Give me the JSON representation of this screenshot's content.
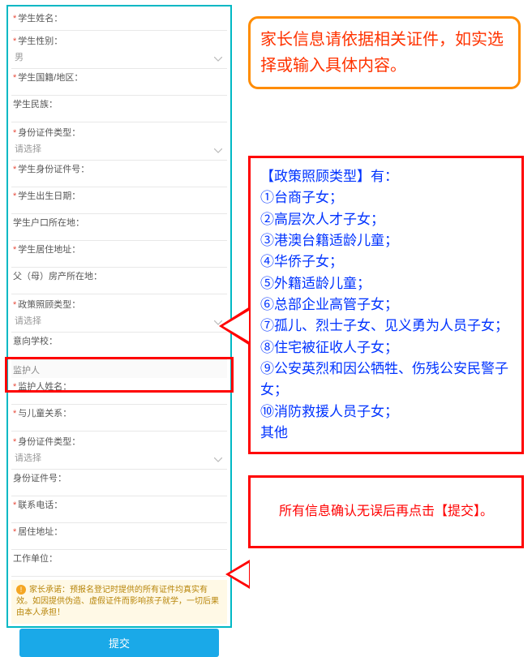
{
  "form": {
    "studentName": "学生姓名：",
    "studentGender": "学生性别：",
    "studentGenderVal": "男",
    "studentNationality": "学生国籍/地区：",
    "studentEthnicity": "学生民族：",
    "idType": "身份证件类型：",
    "idTypeVal": "请选择",
    "studentIdNo": "学生身份证件号：",
    "studentBirth": "学生出生日期：",
    "studentHukou": "学生户口所在地：",
    "studentResidence": "学生居住地址：",
    "parentProperty": "父（母）房产所在地：",
    "policyType": "政策照顾类型：",
    "policyTypeVal": "请选择",
    "intendedSchool": "意向学校：",
    "guardianSection": "监护人",
    "guardianName": "监护人姓名：",
    "childRelation": "与儿童关系：",
    "guardianIdType": "身份证件类型：",
    "guardianIdTypeVal": "请选择",
    "guardianIdNo": "身份证件号：",
    "contactPhone": "联系电话：",
    "residenceAddr": "居住地址：",
    "workUnit": "工作单位："
  },
  "warning": "家长承诺：预报名登记时提供的所有证件均真实有效。如因提供伪造、虚假证件而影响孩子就学，一切后果由本人承担！",
  "submitLabel": "提交",
  "callout1": "家长信息请依据相关证件，如实选择或输入具体内容。",
  "callout2": {
    "title": "【政策照顾类型】有：",
    "items": [
      "①台商子女；",
      "②高层次人才子女；",
      "③港澳台籍适龄儿童；",
      "④华侨子女；",
      "⑤外籍适龄儿童；",
      "⑥总部企业高管子女；",
      "⑦孤儿、烈士子女、见义勇为人员子女；",
      "⑧住宅被征收人子女；",
      "⑨公安英烈和因公牺牲、伤残公安民警子女；",
      "⑩消防救援人员子女；",
      "其他"
    ]
  },
  "callout3": "所有信息确认无误后再点击【提交】。"
}
